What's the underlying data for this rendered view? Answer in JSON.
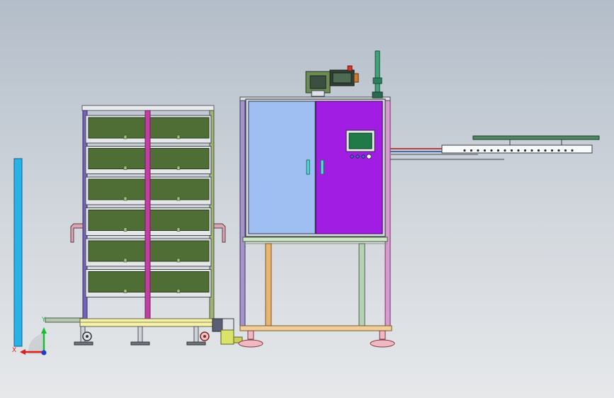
{
  "viewport": {
    "background_top": "#b3bdc9",
    "background_bottom": "#e6e8ea"
  },
  "colors": {
    "tray": "#4e6e36",
    "tray_edge": "#2c3d1e",
    "door_left": "#9fbff3",
    "door_right": "#a21de3",
    "hmi_screen": "#1f7a48",
    "upright_magenta": "#c23fa2",
    "upright_purple": "#7464b6",
    "base_yellow": "#f5f1aa",
    "cyan_post": "#27b3ea",
    "orange_leg": "#e9b56f",
    "green_leg": "#b4d3b6",
    "motor": "#3b5040",
    "rail_green": "#4d8a63"
  },
  "triad": {
    "x_label": "X",
    "y_label": "Y",
    "x_color": "#e21c1c",
    "y_color": "#16c12e",
    "z_color": "#1d3ad6"
  },
  "components": {
    "rack_tray_count": 6,
    "hmi_button_count": 4,
    "icons": [
      "hmi-panel-icon",
      "servo-motor-icon",
      "signal-tower-icon",
      "caster-wheel-icon",
      "leveling-foot-icon",
      "view-triad-icon"
    ]
  }
}
